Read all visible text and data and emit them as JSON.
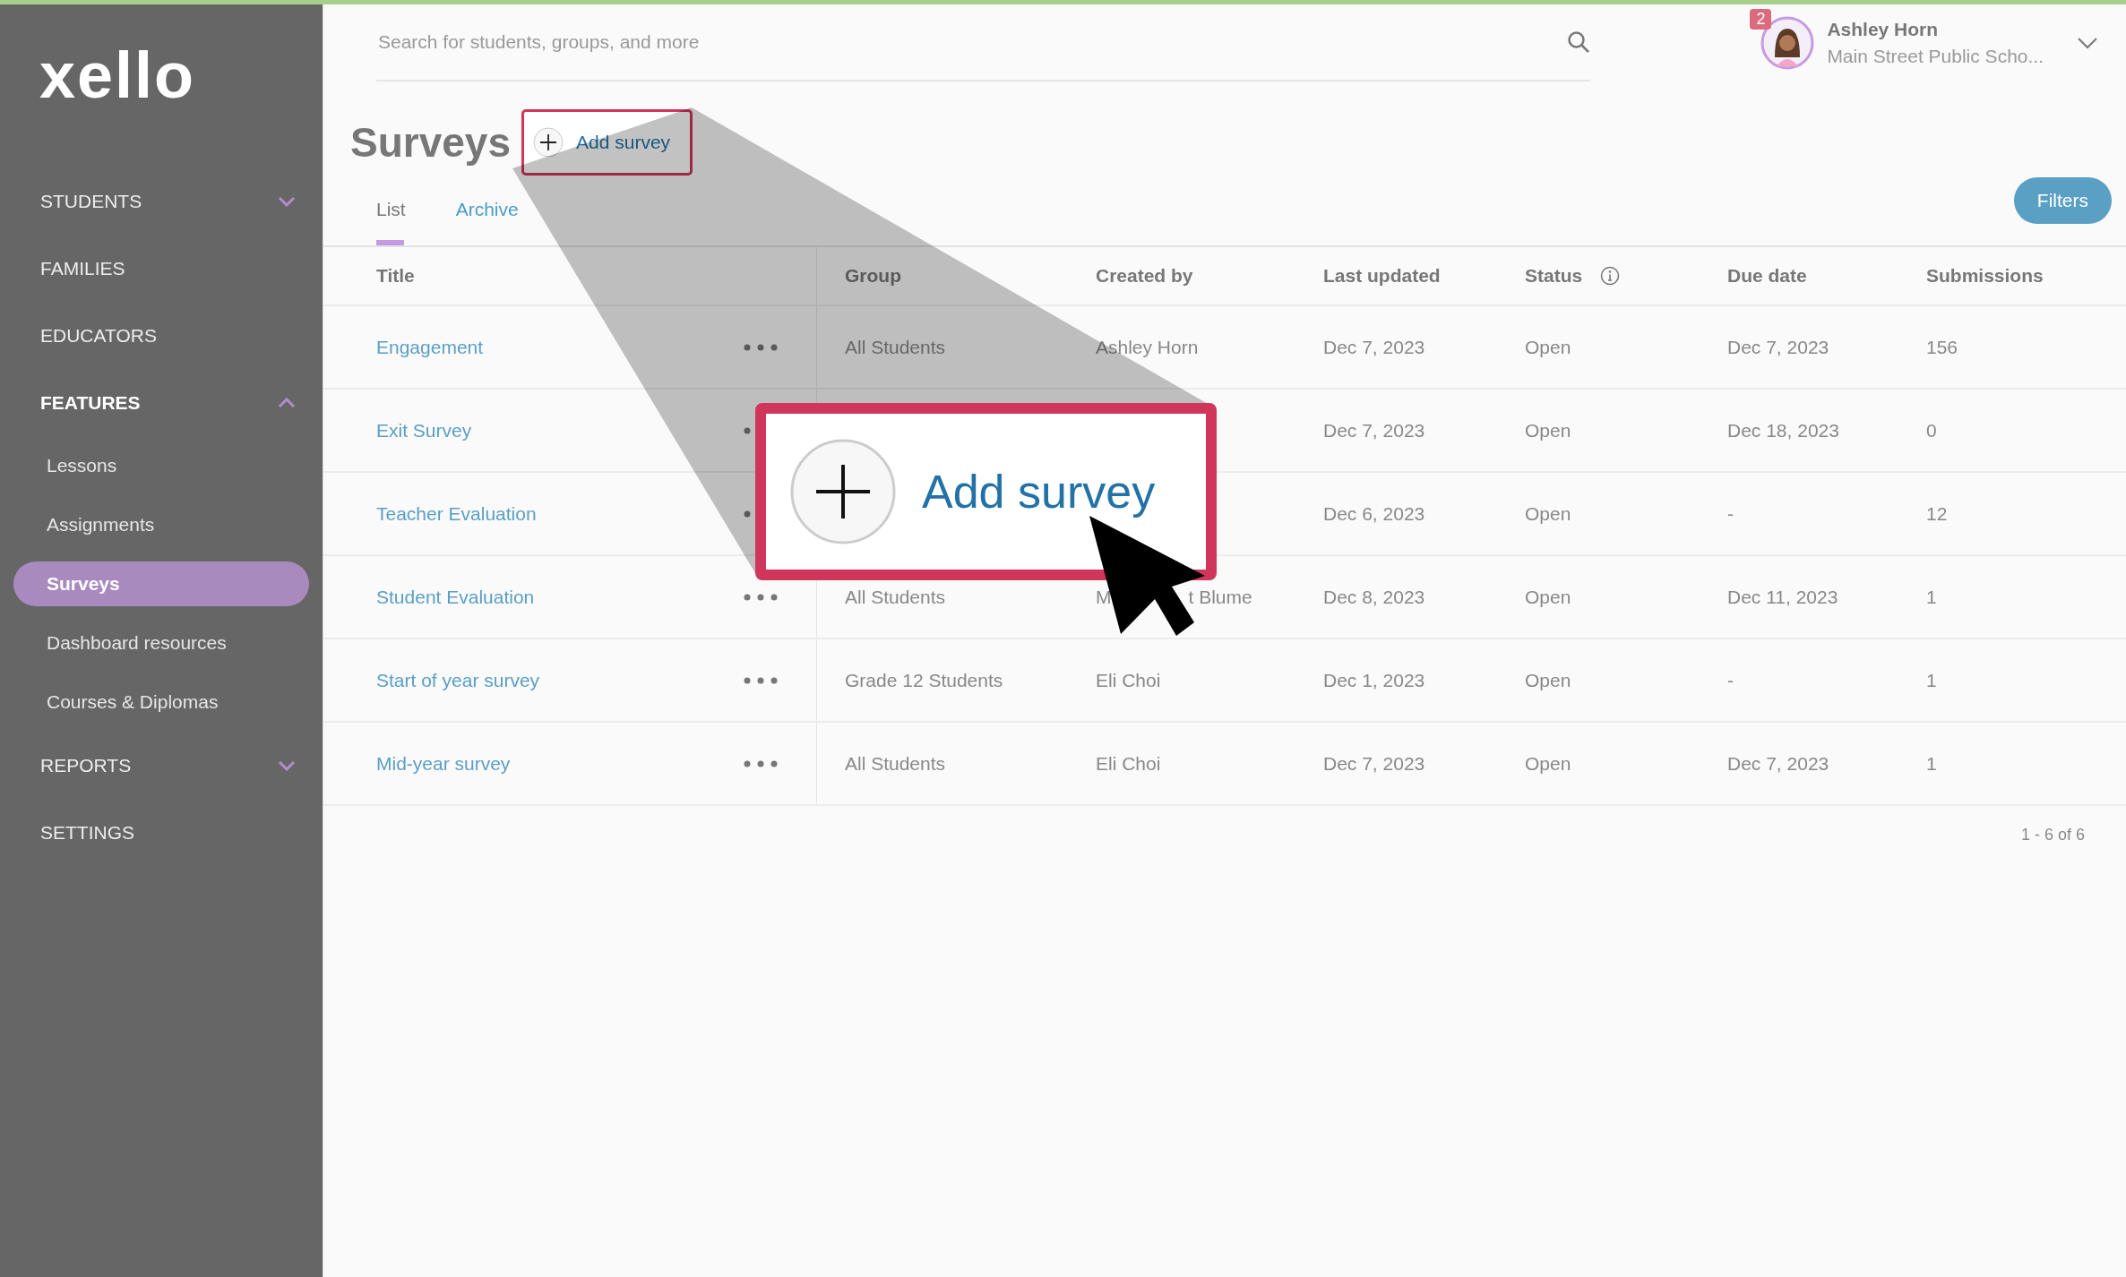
{
  "sidebar": {
    "logo": "xello",
    "nav": [
      {
        "label": "STUDENTS",
        "kind": "group",
        "expanded": false
      },
      {
        "label": "FAMILIES",
        "kind": "link"
      },
      {
        "label": "EDUCATORS",
        "kind": "link"
      },
      {
        "label": "FEATURES",
        "kind": "group",
        "expanded": true,
        "children": [
          {
            "label": "Lessons",
            "selected": false
          },
          {
            "label": "Assignments",
            "selected": false
          },
          {
            "label": "Surveys",
            "selected": true
          },
          {
            "label": "Dashboard resources",
            "selected": false
          },
          {
            "label": "Courses & Diplomas",
            "selected": false
          }
        ]
      },
      {
        "label": "REPORTS",
        "kind": "group",
        "expanded": false
      },
      {
        "label": "SETTINGS",
        "kind": "link"
      }
    ]
  },
  "header": {
    "search": {
      "placeholder": "Search for students, groups, and more"
    },
    "user": {
      "name": "Ashley Horn",
      "school": "Main Street Public Scho...",
      "badge": "2"
    }
  },
  "page": {
    "title": "Surveys",
    "add_button": "Add survey",
    "filters_button": "Filters",
    "tabs": [
      {
        "label": "List",
        "selected": true
      },
      {
        "label": "Archive",
        "selected": false
      }
    ]
  },
  "table": {
    "columns": [
      "Title",
      "Group",
      "Created by",
      "Last updated",
      "Status",
      "Due date",
      "Submissions"
    ],
    "rows": [
      {
        "title": "Engagement",
        "group": "All Students",
        "created_by": [
          "Ashley Horn"
        ],
        "last_updated": "Dec 7, 2023",
        "status": "Open",
        "due_date": "Dec 7, 2023",
        "submissions": "156"
      },
      {
        "title": "Exit Survey",
        "menu_covered": true,
        "last_updated": "Dec 7, 2023",
        "status": "Open",
        "due_date": "Dec 18, 2023",
        "submissions": "0"
      },
      {
        "title": "Teacher Evaluation",
        "menu_covered": true,
        "last_updated": "Dec 6, 2023",
        "status": "Open",
        "due_date": "-",
        "submissions": "12"
      },
      {
        "title": "Student Evaluation",
        "group": "All Students",
        "created_by": [
          "M",
          "t Blume"
        ],
        "last_updated": "Dec 8, 2023",
        "status": "Open",
        "due_date": "Dec 11, 2023",
        "submissions": "1"
      },
      {
        "title": "Start of year survey",
        "group": "Grade 12 Students",
        "created_by": [
          "Eli Choi"
        ],
        "last_updated": "Dec 1, 2023",
        "status": "Open",
        "due_date": "-",
        "submissions": "1"
      },
      {
        "title": "Mid-year survey",
        "group": "All Students",
        "created_by": [
          "Eli Choi"
        ],
        "last_updated": "Dec 7, 2023",
        "status": "Open",
        "due_date": "Dec 7, 2023",
        "submissions": "1"
      }
    ],
    "pagination": "1 - 6 of 6"
  },
  "callout": {
    "label": "Add survey"
  }
}
